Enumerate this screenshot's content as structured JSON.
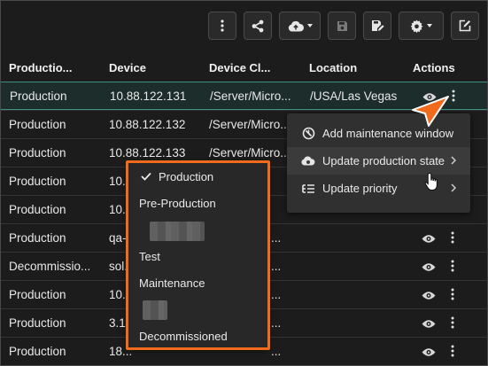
{
  "toolbar": {
    "buttons": [
      {
        "name": "more-options",
        "icon": "vertical-dots-icon"
      },
      {
        "name": "share",
        "icon": "share-icon"
      },
      {
        "name": "cloud-upload",
        "icon": "cloud-upload-icon",
        "dropdown": true
      },
      {
        "name": "save",
        "icon": "floppy-disk-icon",
        "disabled": true
      },
      {
        "name": "save-as",
        "icon": "save-as-icon"
      },
      {
        "name": "settings",
        "icon": "gear-icon",
        "dropdown": true
      },
      {
        "name": "edit",
        "icon": "edit-icon"
      }
    ]
  },
  "table": {
    "headers": [
      "Productio...",
      "Device",
      "Device Cl...",
      "Location",
      "Actions"
    ],
    "rows": [
      {
        "state": "Production",
        "device": "10.88.122.131",
        "class": "/Server/Micro...",
        "location": "/USA/Las Vegas"
      },
      {
        "state": "Production",
        "device": "10.88.122.132",
        "class": "/Server/Micro...",
        "location": ""
      },
      {
        "state": "Production",
        "device": "10.88.122.133",
        "class": "/Server/Micro...",
        "location": ""
      },
      {
        "state": "Production",
        "device": "10...",
        "class": "",
        "location": ""
      },
      {
        "state": "Production",
        "device": "10...",
        "class": "",
        "location": ""
      },
      {
        "state": "Production",
        "device": "qa-...",
        "class": "...",
        "location": ""
      },
      {
        "state": "Decommissio...",
        "device": "sol...",
        "class": "...",
        "location": ""
      },
      {
        "state": "Production",
        "device": "10...",
        "class": "...",
        "location": ""
      },
      {
        "state": "Production",
        "device": "3.1...",
        "class": "...",
        "location": ""
      },
      {
        "state": "Production",
        "device": "18...",
        "class": "...",
        "location": ""
      }
    ]
  },
  "context_menu": {
    "items": [
      {
        "label": "Add maintenance window",
        "icon": "maintenance-window-icon"
      },
      {
        "label": "Update production state",
        "icon": "production-state-icon",
        "submenu": true
      },
      {
        "label": "Update priority",
        "icon": "priority-list-icon",
        "submenu": true
      }
    ]
  },
  "production_state_submenu": {
    "selected": "Production",
    "items": [
      "Production",
      "Pre-Production",
      "Test",
      "Maintenance",
      "Decommissioned"
    ]
  },
  "colors": {
    "background": "#1c1c1c",
    "selected_row_border": "#3f8f86",
    "highlight": "#f26b1d"
  }
}
